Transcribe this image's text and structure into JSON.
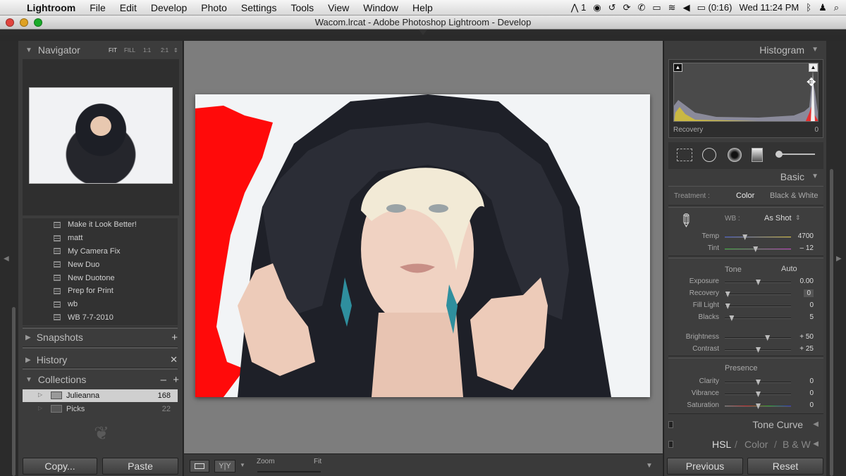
{
  "menubar": {
    "app": "Lightroom",
    "items": [
      "File",
      "Edit",
      "Develop",
      "Photo",
      "Settings",
      "Tools",
      "View",
      "Window",
      "Help"
    ],
    "status_1": "1",
    "battery": "(0:16)",
    "clock": "Wed 11:24 PM"
  },
  "window": {
    "title": "Wacom.lrcat - Adobe Photoshop Lightroom - Develop"
  },
  "navigator": {
    "title": "Navigator",
    "zoom_options": [
      "FIT",
      "FILL",
      "1:1",
      "2:1"
    ]
  },
  "presets": [
    "Make it Look Better!",
    "matt",
    "My Camera Fix",
    "New Duo",
    "New Duotone",
    "Prep for Print",
    "wb",
    "WB 7-7-2010"
  ],
  "panels": {
    "snapshots": "Snapshots",
    "history": "History",
    "collections": "Collections"
  },
  "collections": [
    {
      "name": "Julieanna",
      "count": "168"
    },
    {
      "name": "Picks",
      "count": "22"
    }
  ],
  "left_buttons": {
    "copy": "Copy...",
    "paste": "Paste"
  },
  "toolbar": {
    "zoom": "Zoom",
    "fit": "Fit"
  },
  "histogram": {
    "title": "Histogram",
    "label": "Recovery",
    "value": "0"
  },
  "basic": {
    "title": "Basic",
    "treatment_label": "Treatment :",
    "color": "Color",
    "bw": "Black & White",
    "wb_label": "WB :",
    "wb_value": "As Shot",
    "tone_label": "Tone",
    "auto": "Auto",
    "presence_label": "Presence",
    "sliders": [
      {
        "label": "Temp",
        "value": "4700",
        "pos": 0.3
      },
      {
        "label": "Tint",
        "value": "– 12",
        "pos": 0.46
      },
      {
        "label": "Exposure",
        "value": "0.00",
        "pos": 0.5
      },
      {
        "label": "Recovery",
        "value": "0",
        "pos": 0.04
      },
      {
        "label": "Fill Light",
        "value": "0",
        "pos": 0.04
      },
      {
        "label": "Blacks",
        "value": "5",
        "pos": 0.1
      },
      {
        "label": "Brightness",
        "value": "+ 50",
        "pos": 0.64
      },
      {
        "label": "Contrast",
        "value": "+ 25",
        "pos": 0.5
      },
      {
        "label": "Clarity",
        "value": "0",
        "pos": 0.5
      },
      {
        "label": "Vibrance",
        "value": "0",
        "pos": 0.5
      },
      {
        "label": "Saturation",
        "value": "0",
        "pos": 0.5
      }
    ]
  },
  "right_panels": {
    "tone_curve": "Tone Curve",
    "hsl": "HSL",
    "color": "Color",
    "bw": "B & W"
  },
  "right_buttons": {
    "previous": "Previous",
    "reset": "Reset"
  }
}
